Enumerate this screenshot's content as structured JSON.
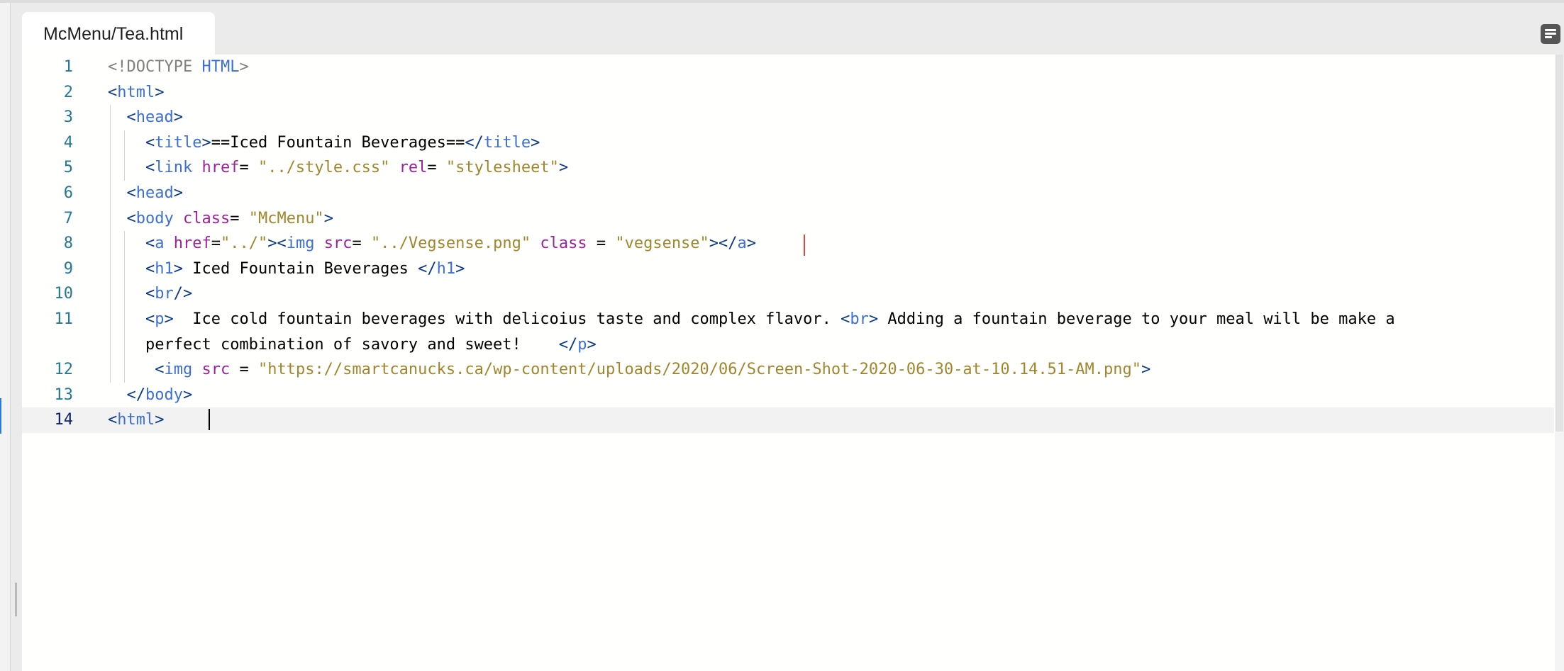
{
  "tab": {
    "title": "McMenu/Tea.html"
  },
  "toolbar": {
    "panel_toggle_icon": "panel-toggle-icon"
  },
  "editor": {
    "current_line": 14,
    "lines": [
      {
        "number": "1",
        "tokens": [
          [
            "doctype",
            "<!DOCTYPE "
          ],
          [
            "tag",
            "HTML"
          ],
          [
            "doctype",
            ">"
          ]
        ]
      },
      {
        "number": "2",
        "tokens": [
          [
            "bracket",
            "<"
          ],
          [
            "tag",
            "html"
          ],
          [
            "bracket",
            ">"
          ]
        ]
      },
      {
        "number": "3",
        "tokens": [
          [
            "txt",
            "  "
          ],
          [
            "bracket",
            "<"
          ],
          [
            "tag",
            "head"
          ],
          [
            "bracket",
            ">"
          ]
        ]
      },
      {
        "number": "4",
        "tokens": [
          [
            "txt",
            "    "
          ],
          [
            "bracket",
            "<"
          ],
          [
            "tag",
            "title"
          ],
          [
            "bracket",
            ">"
          ],
          [
            "txt",
            "==Iced Fountain Beverages=="
          ],
          [
            "bracket",
            "</"
          ],
          [
            "tag",
            "title"
          ],
          [
            "bracket",
            ">"
          ]
        ]
      },
      {
        "number": "5",
        "tokens": [
          [
            "txt",
            "    "
          ],
          [
            "bracket",
            "<"
          ],
          [
            "tag",
            "link "
          ],
          [
            "attr",
            "href"
          ],
          [
            "txt",
            "= "
          ],
          [
            "str",
            "\"../style.css\""
          ],
          [
            "txt",
            " "
          ],
          [
            "attr",
            "rel"
          ],
          [
            "txt",
            "= "
          ],
          [
            "str",
            "\"stylesheet\""
          ],
          [
            "bracket",
            ">"
          ]
        ]
      },
      {
        "number": "6",
        "tokens": [
          [
            "txt",
            "  "
          ],
          [
            "bracket",
            "<"
          ],
          [
            "tag",
            "head"
          ],
          [
            "bracket",
            ">"
          ]
        ]
      },
      {
        "number": "7",
        "tokens": [
          [
            "txt",
            "  "
          ],
          [
            "bracket",
            "<"
          ],
          [
            "tag",
            "body "
          ],
          [
            "attr",
            "class"
          ],
          [
            "txt",
            "= "
          ],
          [
            "str",
            "\"McMenu\""
          ],
          [
            "bracket",
            ">"
          ]
        ]
      },
      {
        "number": "8",
        "tokens": [
          [
            "txt",
            "    "
          ],
          [
            "bracket",
            "<"
          ],
          [
            "tag",
            "a "
          ],
          [
            "attr",
            "href"
          ],
          [
            "txt",
            "="
          ],
          [
            "str",
            "\"../\""
          ],
          [
            "bracket",
            "><"
          ],
          [
            "tag",
            "img "
          ],
          [
            "attr",
            "src"
          ],
          [
            "txt",
            "= "
          ],
          [
            "str",
            "\"../Vegsense.png\""
          ],
          [
            "txt",
            " "
          ],
          [
            "attr",
            "class"
          ],
          [
            "txt",
            " = "
          ],
          [
            "str",
            "\"vegsense\""
          ],
          [
            "bracket",
            "></"
          ],
          [
            "tag",
            "a"
          ],
          [
            "bracket",
            ">"
          ]
        ]
      },
      {
        "number": "9",
        "tokens": [
          [
            "txt",
            "    "
          ],
          [
            "bracket",
            "<"
          ],
          [
            "tag",
            "h1"
          ],
          [
            "bracket",
            ">"
          ],
          [
            "txt",
            " Iced Fountain Beverages "
          ],
          [
            "bracket",
            "</"
          ],
          [
            "tag",
            "h1"
          ],
          [
            "bracket",
            ">"
          ]
        ]
      },
      {
        "number": "10",
        "tokens": [
          [
            "txt",
            "    "
          ],
          [
            "bracket",
            "<"
          ],
          [
            "tag",
            "br"
          ],
          [
            "bracket",
            "/>"
          ]
        ]
      },
      {
        "number": "11",
        "wrap": true,
        "tokens": [
          [
            "txt",
            "    "
          ],
          [
            "bracket",
            "<"
          ],
          [
            "tag",
            "p"
          ],
          [
            "bracket",
            ">"
          ],
          [
            "txt",
            "  Ice cold fountain beverages with delicoius taste and complex flavor. "
          ],
          [
            "bracket",
            "<"
          ],
          [
            "tag",
            "br"
          ],
          [
            "bracket",
            ">"
          ],
          [
            "txt",
            " Adding a fountain beverage to your meal will be make a\n    perfect combination of savory and sweet!    "
          ],
          [
            "bracket",
            "</"
          ],
          [
            "tag",
            "p"
          ],
          [
            "bracket",
            ">"
          ]
        ]
      },
      {
        "number": "12",
        "tokens": [
          [
            "txt",
            "     "
          ],
          [
            "bracket",
            "<"
          ],
          [
            "tag",
            "img "
          ],
          [
            "attr",
            "src"
          ],
          [
            "txt",
            " = "
          ],
          [
            "str",
            "\"https://smartcanucks.ca/wp-content/uploads/2020/06/Screen-Shot-2020-06-30-at-10.14.51-AM.png\""
          ],
          [
            "bracket",
            ">"
          ]
        ]
      },
      {
        "number": "13",
        "tokens": [
          [
            "txt",
            "  "
          ],
          [
            "bracket",
            "</"
          ],
          [
            "tag",
            "body"
          ],
          [
            "bracket",
            ">"
          ]
        ]
      },
      {
        "number": "14",
        "tokens": [
          [
            "bracket",
            "<"
          ],
          [
            "tag",
            "html"
          ],
          [
            "bracket",
            ">"
          ]
        ]
      }
    ]
  }
}
